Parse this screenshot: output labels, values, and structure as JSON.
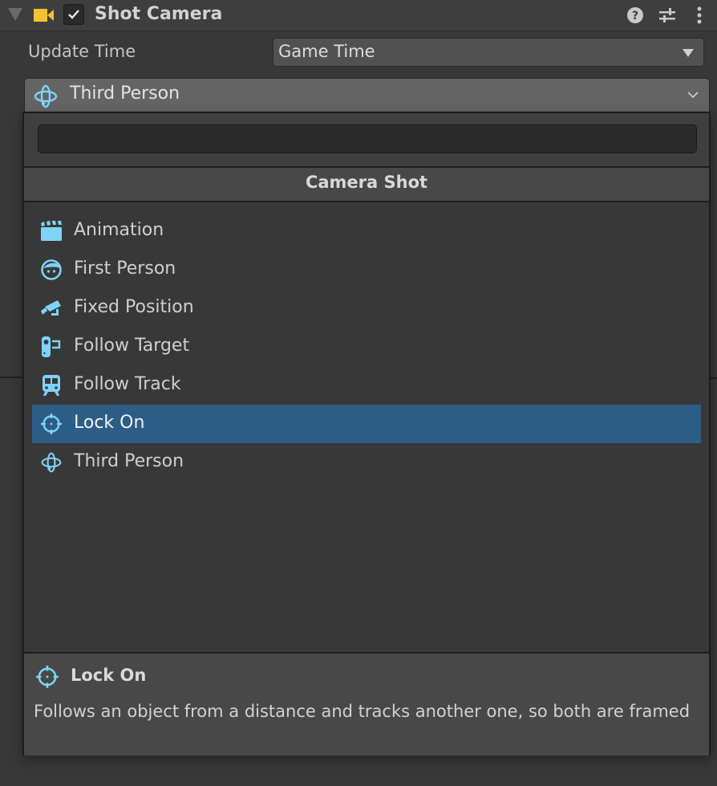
{
  "component": {
    "title": "Shot Camera",
    "enabled": true,
    "header_buttons": [
      "help-icon",
      "presets-icon",
      "more-options-icon"
    ]
  },
  "fields": {
    "update_time": {
      "label": "Update Time",
      "value": "Game Time"
    }
  },
  "shot_type": {
    "current": "Third Person",
    "icon": "third-person-icon"
  },
  "popup": {
    "search": {
      "value": "",
      "placeholder": ""
    },
    "header": "Camera Shot",
    "items": [
      {
        "label": "Animation",
        "icon": "clapperboard-icon"
      },
      {
        "label": "First Person",
        "icon": "face-icon"
      },
      {
        "label": "Fixed Position",
        "icon": "security-camera-icon"
      },
      {
        "label": "Follow Target",
        "icon": "follow-target-icon"
      },
      {
        "label": "Follow Track",
        "icon": "train-icon"
      },
      {
        "label": "Lock On",
        "icon": "crosshair-icon",
        "selected": true
      },
      {
        "label": "Third Person",
        "icon": "third-person-icon"
      }
    ],
    "description": {
      "title": "Lock On",
      "icon": "crosshair-icon",
      "text": "Follows an object from a distance and tracks another one, so both are framed"
    }
  },
  "colors": {
    "accent_icon": "#7fd3f7",
    "selection": "#2c5d87",
    "camera_icon": "#f2c230"
  }
}
